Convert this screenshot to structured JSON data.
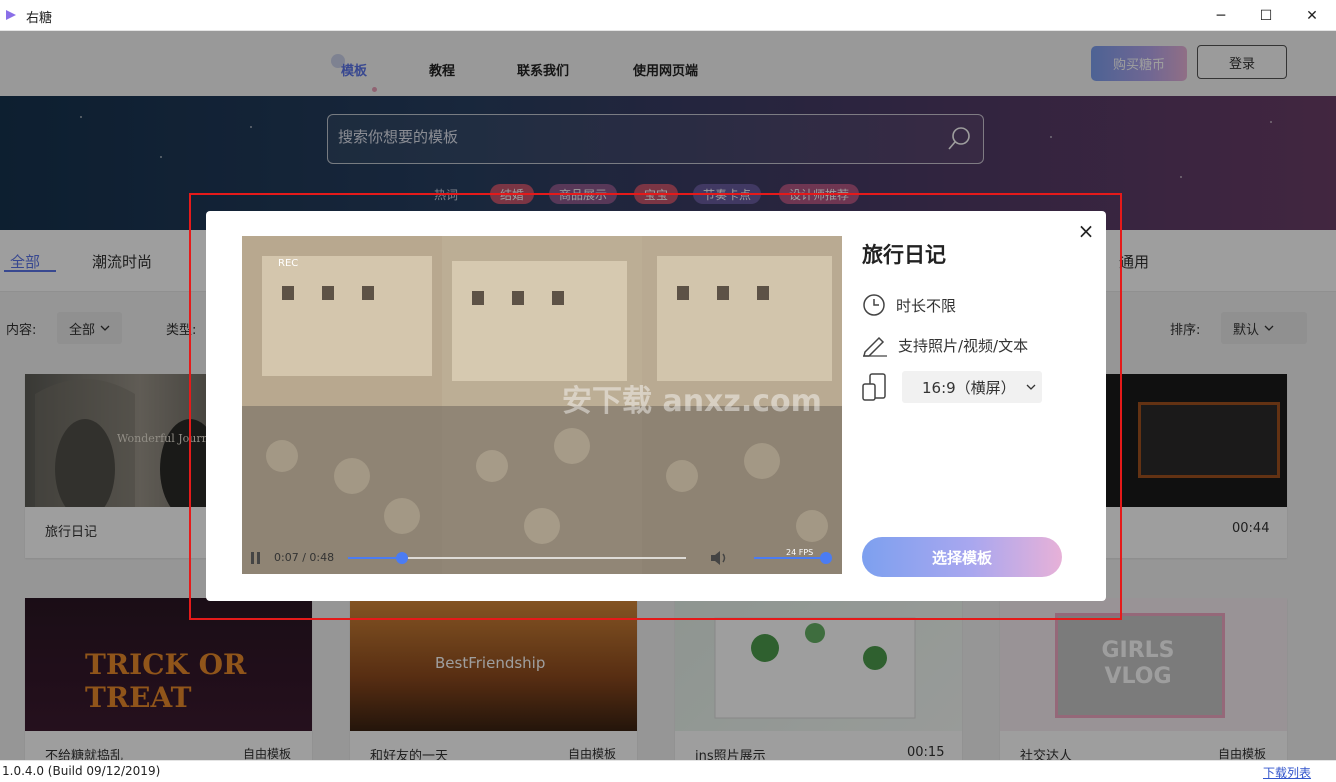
{
  "window": {
    "title": "右糖",
    "min_label": "─",
    "max_label": "☐",
    "close_label": "✕"
  },
  "nav": {
    "items": [
      "模板",
      "教程",
      "联系我们",
      "使用网页端"
    ],
    "buy_label": "购买糖币",
    "login_label": "登录",
    "accent": "#5b74e8"
  },
  "hero": {
    "search_placeholder": "搜索你想要的模板",
    "hot_label": "热词",
    "hot_tags": [
      "结婚",
      "商品展示",
      "宝宝",
      "节奏卡点",
      "设计师推荐"
    ]
  },
  "categories": {
    "items": [
      "全部",
      "潮流时尚",
      "通用"
    ]
  },
  "filters": {
    "content_label": "内容:",
    "content_value": "全部",
    "type_label": "类型:",
    "sort_label": "排序:",
    "sort_value": "默认"
  },
  "cards": [
    {
      "title": "旅行日记",
      "thumb_text": "Wonderful Journ"
    },
    {
      "title": "",
      "duration": "00:44"
    },
    {
      "title": "不给糖就捣乱",
      "tag": "自由模板",
      "thumb_text": "TRICK OR TREAT"
    },
    {
      "title": "和好友的一天",
      "tag": "自由模板",
      "thumb_text": "BestFriendship"
    },
    {
      "title": "ins照片展示",
      "duration": "00:15"
    },
    {
      "title": "社交达人",
      "tag": "自由模板",
      "thumb_text": "GIRLS VLOG"
    }
  ],
  "status": {
    "version": "1.0.4.0 (Build 09/12/2019)",
    "download_list": "下载列表"
  },
  "modal": {
    "title": "旅行日记",
    "duration_attr": "时长不限",
    "support_attr": "支持照片/视频/文本",
    "ratio_value": "16:9（横屏）",
    "choose_label": "选择模板",
    "close_label": "×",
    "player": {
      "time": "0:07 / 0:48",
      "progress_fraction": 0.16,
      "rec_label": "REC",
      "fps_label": "24 FPS",
      "watermark": "安下载 anxz.com"
    }
  }
}
